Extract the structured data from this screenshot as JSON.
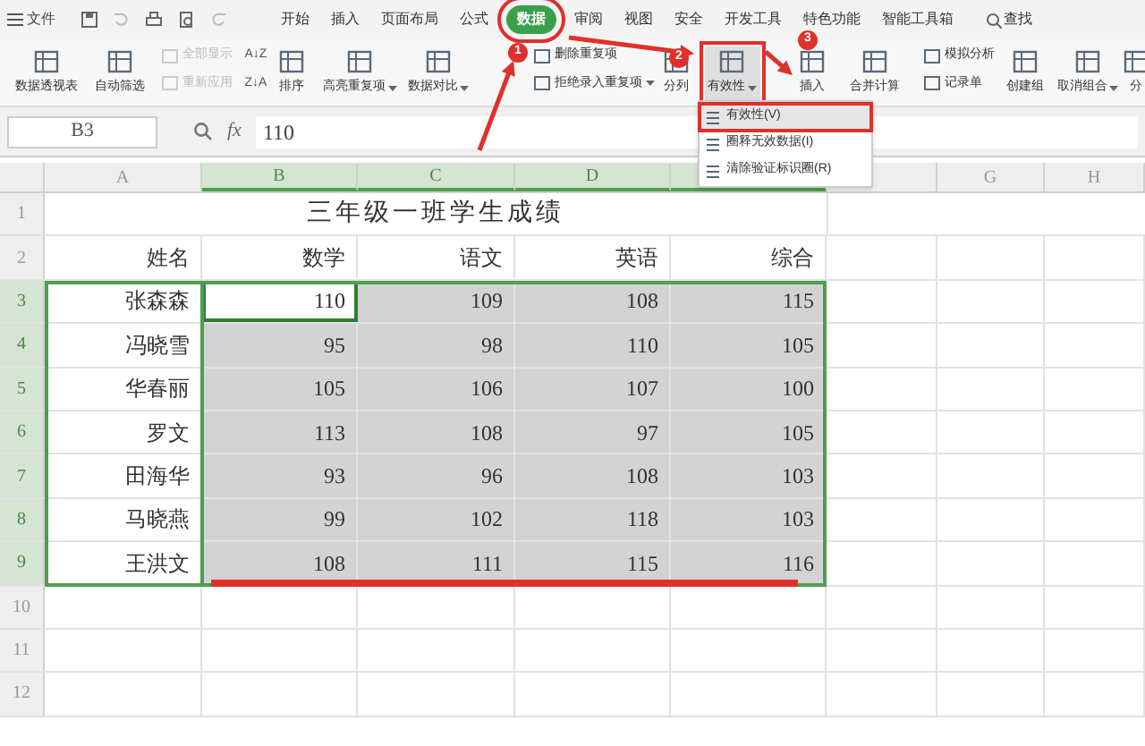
{
  "menu": {
    "file": "文件"
  },
  "tabs": [
    {
      "label": "开始",
      "selected": false
    },
    {
      "label": "插入",
      "selected": false
    },
    {
      "label": "页面布局",
      "selected": false
    },
    {
      "label": "公式",
      "selected": false
    },
    {
      "label": "数据",
      "selected": true
    },
    {
      "label": "审阅",
      "selected": false
    },
    {
      "label": "视图",
      "selected": false
    },
    {
      "label": "安全",
      "selected": false
    },
    {
      "label": "开发工具",
      "selected": false
    },
    {
      "label": "特色功能",
      "selected": false
    },
    {
      "label": "智能工具箱",
      "selected": false
    }
  ],
  "search": "查找",
  "ribbon": [
    {
      "kind": "large",
      "label": "数据透视表",
      "dropdown": false,
      "pressed": false
    },
    {
      "kind": "large",
      "label": "自动筛选",
      "dropdown": false,
      "pressed": false
    },
    {
      "kind": "stack",
      "items": [
        {
          "label": "全部显示",
          "disabled": true,
          "dropdown": false
        },
        {
          "label": "重新应用",
          "disabled": true,
          "dropdown": false
        }
      ]
    },
    {
      "kind": "sort",
      "labels": [
        "A↓Z",
        "Z↓A"
      ]
    },
    {
      "kind": "large",
      "label": "排序",
      "dropdown": false,
      "pressed": false
    },
    {
      "kind": "large",
      "label": "高亮重复项",
      "dropdown": true,
      "pressed": false
    },
    {
      "kind": "large",
      "label": "数据对比",
      "dropdown": true,
      "pressed": false
    },
    {
      "kind": "stack",
      "items": [
        {
          "label": "删除重复项",
          "disabled": false,
          "dropdown": false
        },
        {
          "label": "拒绝录入重复项",
          "disabled": false,
          "dropdown": true
        }
      ]
    },
    {
      "kind": "large",
      "label": "分列",
      "dropdown": false,
      "pressed": false
    },
    {
      "kind": "large",
      "label": "有效性",
      "dropdown": true,
      "pressed": true
    },
    {
      "kind": "large",
      "label": "插入",
      "dropdown": false,
      "pressed": false
    },
    {
      "kind": "large",
      "label": "合并计算",
      "dropdown": false,
      "pressed": false
    },
    {
      "kind": "stack",
      "items": [
        {
          "label": "模拟分析",
          "disabled": false,
          "dropdown": false
        },
        {
          "label": "记录单",
          "disabled": false,
          "dropdown": false
        }
      ]
    },
    {
      "kind": "large",
      "label": "创建组",
      "dropdown": false,
      "pressed": false
    },
    {
      "kind": "large",
      "label": "取消组合",
      "dropdown": true,
      "pressed": false
    },
    {
      "kind": "large",
      "label": "分",
      "dropdown": false,
      "pressed": false
    }
  ],
  "dropdown_menu": [
    {
      "label": "有效性(V)",
      "selected": true
    },
    {
      "label": "圈释无效数据(I)",
      "selected": false
    },
    {
      "label": "清除验证标识圈(R)",
      "selected": false
    }
  ],
  "formula_bar": {
    "name_box": "B3",
    "fx": "fx",
    "value": "110"
  },
  "columns": [
    {
      "label": "A",
      "selected": false
    },
    {
      "label": "B",
      "selected": true
    },
    {
      "label": "C",
      "selected": true
    },
    {
      "label": "D",
      "selected": true
    },
    {
      "selected": true
    },
    {
      "selected": false
    },
    {
      "label": "G",
      "selected": false
    },
    {
      "label": "H",
      "selected": false
    }
  ],
  "rows": [
    {
      "number": "1",
      "kind": "title",
      "text": "三年级一班学生成绩",
      "selected": false
    },
    {
      "number": "2",
      "kind": "data",
      "selected": false,
      "cells": [
        {
          "text": "姓名",
          "active": false
        },
        {
          "text": "数学",
          "active": false
        },
        {
          "text": "语文",
          "active": false
        },
        {
          "text": "英语",
          "active": false
        },
        {
          "text": "综合",
          "active": false
        }
      ]
    },
    {
      "number": "3",
      "kind": "data",
      "selected": true,
      "cells": [
        {
          "text": "张森森",
          "active": false
        },
        {
          "text": "110",
          "active": true
        },
        {
          "text": "109",
          "active": false
        },
        {
          "text": "108",
          "active": false
        },
        {
          "text": "115",
          "active": false
        }
      ]
    },
    {
      "number": "4",
      "kind": "data",
      "selected": true,
      "cells": [
        {
          "text": "冯晓雪",
          "active": false
        },
        {
          "text": "95",
          "active": false
        },
        {
          "text": "98",
          "active": false
        },
        {
          "text": "110",
          "active": false
        },
        {
          "text": "105",
          "active": false
        }
      ]
    },
    {
      "number": "5",
      "kind": "data",
      "selected": true,
      "cells": [
        {
          "text": "华春丽",
          "active": false
        },
        {
          "text": "105",
          "active": false
        },
        {
          "text": "106",
          "active": false
        },
        {
          "text": "107",
          "active": false
        },
        {
          "text": "100",
          "active": false
        }
      ]
    },
    {
      "number": "6",
      "kind": "data",
      "selected": true,
      "cells": [
        {
          "text": "罗文",
          "active": false
        },
        {
          "text": "113",
          "active": false
        },
        {
          "text": "108",
          "active": false
        },
        {
          "text": "97",
          "active": false
        },
        {
          "text": "105",
          "active": false
        }
      ]
    },
    {
      "number": "7",
      "kind": "data",
      "selected": true,
      "cells": [
        {
          "text": "田海华",
          "active": false
        },
        {
          "text": "93",
          "active": false
        },
        {
          "text": "96",
          "active": false
        },
        {
          "text": "108",
          "active": false
        },
        {
          "text": "103",
          "active": false
        }
      ]
    },
    {
      "number": "8",
      "kind": "data",
      "selected": true,
      "cells": [
        {
          "text": "马晓燕",
          "active": false
        },
        {
          "text": "99",
          "active": false
        },
        {
          "text": "102",
          "active": false
        },
        {
          "text": "118",
          "active": false
        },
        {
          "text": "103",
          "active": false
        }
      ]
    },
    {
      "number": "9",
      "kind": "data",
      "selected": true,
      "cells": [
        {
          "text": "王洪文",
          "active": false
        },
        {
          "text": "108",
          "active": false
        },
        {
          "text": "111",
          "active": false
        },
        {
          "text": "115",
          "active": false
        },
        {
          "text": "116",
          "active": false
        }
      ]
    },
    {
      "number": "10",
      "kind": "empty",
      "selected": false
    },
    {
      "number": "11",
      "kind": "empty",
      "selected": false
    },
    {
      "number": "12",
      "kind": "empty",
      "selected": false
    }
  ],
  "annotations": {
    "steps": [
      "1",
      "2",
      "3"
    ]
  }
}
